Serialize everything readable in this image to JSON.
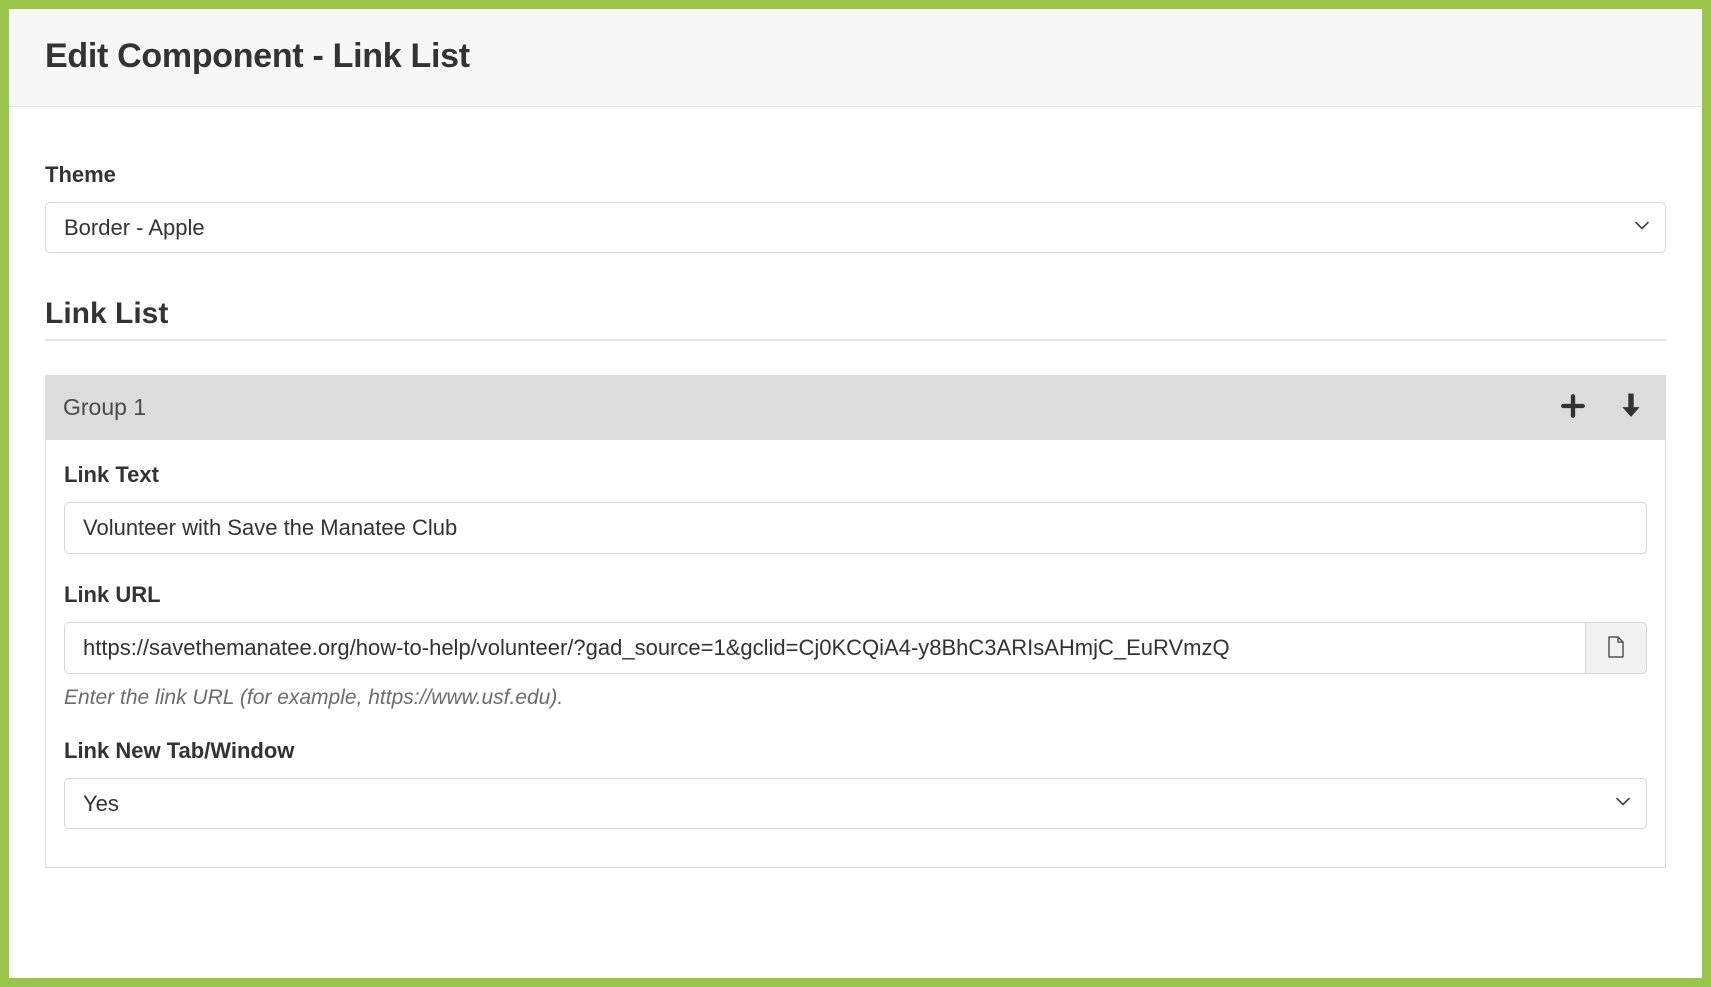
{
  "header": {
    "title": "Edit Component - Link List"
  },
  "theme": {
    "label": "Theme",
    "value": "Border - Apple"
  },
  "section": {
    "title": "Link List"
  },
  "group": {
    "title": "Group 1",
    "link_text": {
      "label": "Link Text",
      "value": "Volunteer with Save the Manatee Club"
    },
    "link_url": {
      "label": "Link URL",
      "value": "https://savethemanatee.org/how-to-help/volunteer/?gad_source=1&gclid=Cj0KCQiA4-y8BhC3ARIsAHmjC_EuRVmzQ",
      "hint": "Enter the link URL (for example, https://www.usf.edu)."
    },
    "link_new_tab": {
      "label": "Link New Tab/Window",
      "value": "Yes"
    }
  }
}
